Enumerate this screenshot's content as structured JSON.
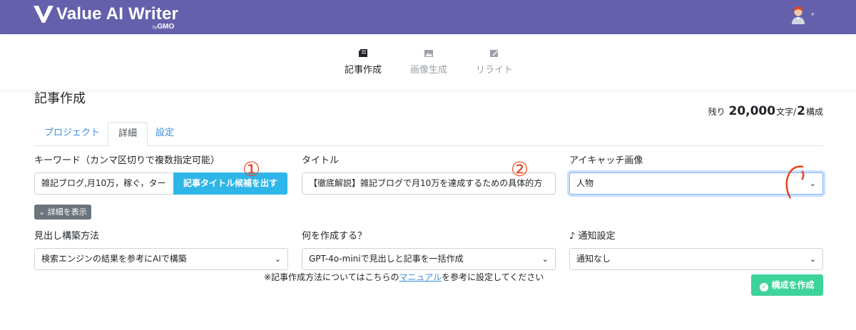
{
  "header": {
    "app_name": "Value AI Writer",
    "by_prefix": "by",
    "by_brand": "GMO",
    "brand_color": "#6560ab",
    "user_menu_caret": "▾"
  },
  "modes": [
    {
      "label": "記事作成",
      "icon": "book-icon",
      "active": true
    },
    {
      "label": "画像生成",
      "icon": "image-icon",
      "active": false
    },
    {
      "label": "リライト",
      "icon": "edit-icon",
      "active": false
    }
  ],
  "page": {
    "title": "記事作成",
    "quota_prefix": "残り",
    "quota_chars": "20,000",
    "quota_chars_unit": "文字/",
    "quota_structures": "2",
    "quota_structures_unit": "構成"
  },
  "tabs": [
    "プロジェクト",
    "詳細",
    "設定"
  ],
  "form": {
    "keyword_label": "キーワード（カンマ区切りで複数指定可能）",
    "keyword_value": "雑記ブログ,月10万，稼ぐ，ター",
    "keyword_button": "記事タイトル候補を出す",
    "title_label": "タイトル",
    "title_value": "【徹底解説】雑記ブログで月10万を達成するための具体的方",
    "eyecatch_label": "アイキャッチ画像",
    "eyecatch_value": "人物",
    "detail_button": "詳細を表示",
    "heading_method_label": "見出し構築方法",
    "heading_method_value": "検索エンジンの結果を参考にAIで構築",
    "what_to_create_label": "何を作成する？",
    "what_to_create_value": "GPT-4o-miniで見出しと記事を一括作成",
    "notification_label": "通知設定",
    "notification_value": "通知なし",
    "note_before": "※記事作成方法についてはこちらの",
    "note_link": "マニュアル",
    "note_after": "を参考に設定してください",
    "create_button": "構成を作成"
  },
  "annotations": [
    "①",
    "②"
  ],
  "colors": {
    "primary_link": "#3d8fe0",
    "keyword_button": "#2fb6e8",
    "create_button": "#3ed39b",
    "annotation": "#e8441c"
  }
}
